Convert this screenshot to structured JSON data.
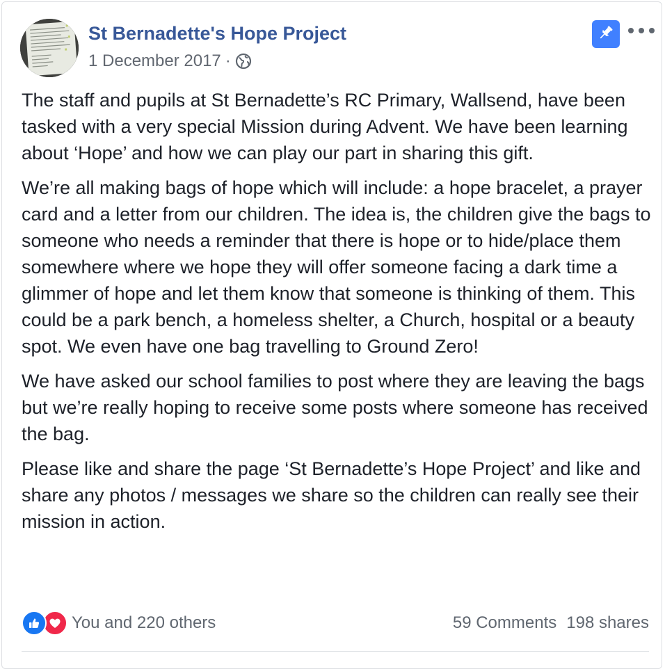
{
  "post": {
    "page_name": "St Bernadette's Hope Project",
    "date": "1 December 2017",
    "separator": "·",
    "privacy_icon": "globe-icon",
    "pin_icon": "pin-icon",
    "more_icon": "more-options-icon",
    "paragraphs": [
      "The staff and pupils at St Bernadette’s RC Primary, Wallsend, have been tasked with a very special Mission during Advent. We have been learning about ‘Hope’ and how we can play our part in sharing this gift.",
      "We’re all making bags of hope which will include: a hope bracelet, a prayer card and a letter from our children. The idea is, the children give the bags to someone who needs a reminder that there is hope or to hide/place them somewhere where we hope they will offer someone facing a dark time a glimmer of hope and let them know that someone is thinking of them. This could be a park bench, a homeless shelter, a Church, hospital or a beauty spot. We even have one bag travelling to Ground Zero!",
      "We have asked our school families to post where they are leaving the bags but we’re really hoping to receive some posts where someone has received the bag.",
      "Please like and share the page ‘St Bernadette’s Hope Project’ and like and share any photos / messages we share so the children can really see their mission in action."
    ]
  },
  "footer": {
    "reactions_text": "You and 220 others",
    "reaction_icons": [
      "like-icon",
      "love-icon"
    ],
    "comments": "59 Comments",
    "shares": "198 shares"
  },
  "colors": {
    "page_name": "#385898",
    "pin_button": "#4080ff",
    "like": "#1877f2",
    "love": "#f0284a",
    "meta_text": "#616770"
  }
}
